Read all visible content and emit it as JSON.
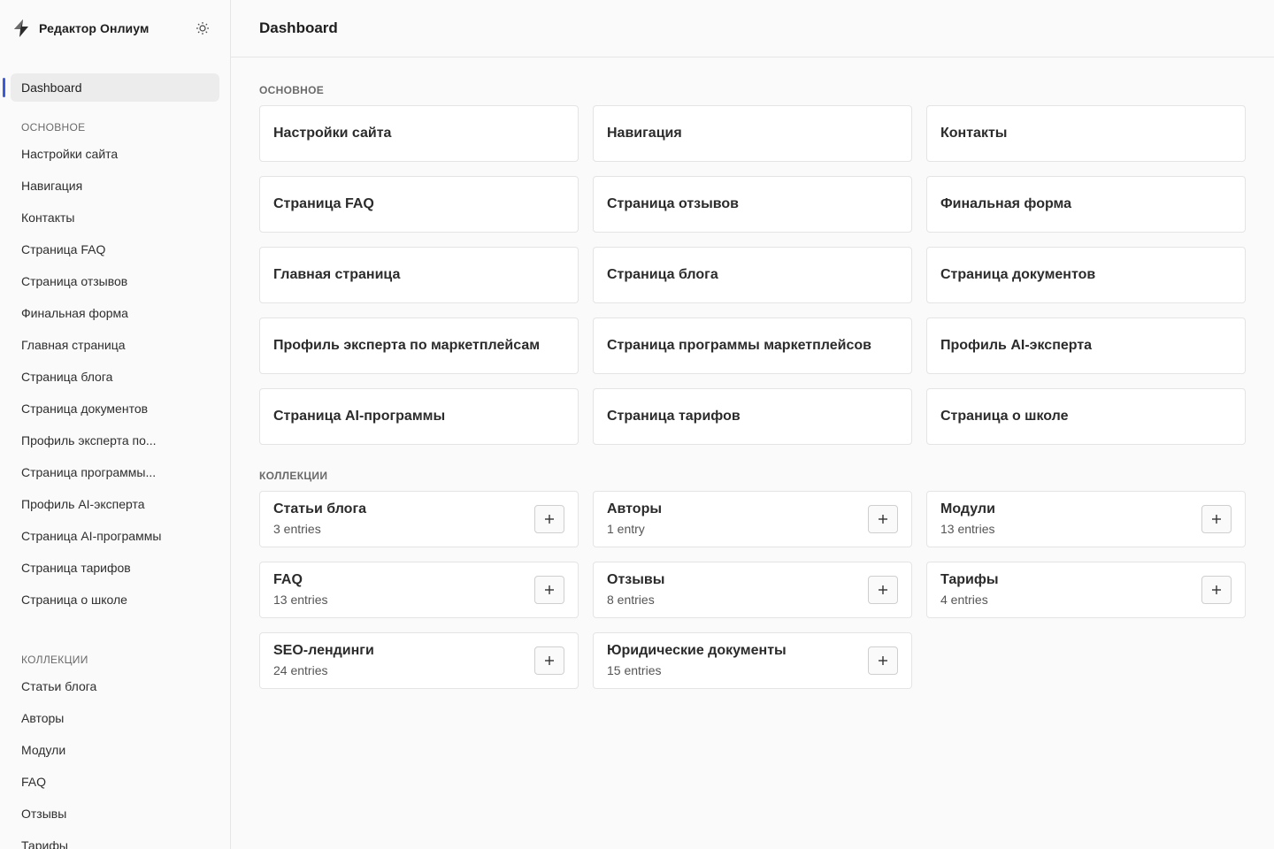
{
  "app": {
    "title": "Редактор Онлиум"
  },
  "header": {
    "title": "Dashboard"
  },
  "sidebar": {
    "active": "Dashboard",
    "main_label": "Основное",
    "collections_label": "Коллекции",
    "main_items": [
      "Настройки сайта",
      "Навигация",
      "Контакты",
      "Страница FAQ",
      "Страница отзывов",
      "Финальная форма",
      "Главная страница",
      "Страница блога",
      "Страница документов",
      "Профиль эксперта по...",
      "Страница программы...",
      "Профиль AI-эксперта",
      "Страница AI-программы",
      "Страница тарифов",
      "Страница о школе"
    ],
    "collection_items": [
      "Статьи блога",
      "Авторы",
      "Модули",
      "FAQ",
      "Отзывы",
      "Тарифы"
    ]
  },
  "main": {
    "singles_label": "Основное",
    "collections_label": "Коллекции",
    "singles": [
      "Настройки сайта",
      "Навигация",
      "Контакты",
      "Страница FAQ",
      "Страница отзывов",
      "Финальная форма",
      "Главная страница",
      "Страница блога",
      "Страница документов",
      "Профиль эксперта по маркетплейсам",
      "Страница программы маркетплейсов",
      "Профиль AI-эксперта",
      "Страница AI-программы",
      "Страница тарифов",
      "Страница о школе"
    ],
    "collections": [
      {
        "title": "Статьи блога",
        "count": "3 entries"
      },
      {
        "title": "Авторы",
        "count": "1 entry"
      },
      {
        "title": "Модули",
        "count": "13 entries"
      },
      {
        "title": "FAQ",
        "count": "13 entries"
      },
      {
        "title": "Отзывы",
        "count": "8 entries"
      },
      {
        "title": "Тарифы",
        "count": "4 entries"
      },
      {
        "title": "SEO-лендинги",
        "count": "24 entries"
      },
      {
        "title": "Юридические документы",
        "count": "15 entries"
      }
    ],
    "add_label": "+"
  },
  "colors": {
    "accent": "#3b5bdb",
    "active_bg": "#ececec",
    "card_border": "#e4e4e4"
  }
}
